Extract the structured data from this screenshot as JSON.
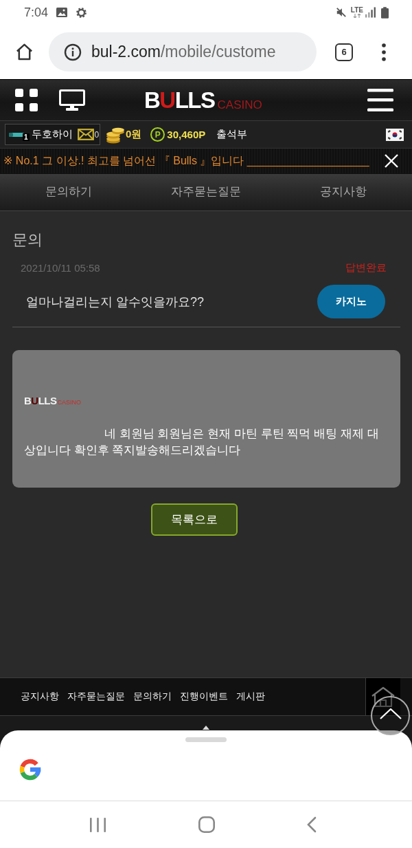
{
  "status_bar": {
    "time": "7:04",
    "network": "LTE"
  },
  "browser": {
    "url_domain": "bul-2.com",
    "url_path": "/mobile/custome",
    "tab_count": "6"
  },
  "header": {
    "logo": "BULLS",
    "logo_sub": "CASINO"
  },
  "user_bar": {
    "rank": "1",
    "nickname": "두호하이",
    "messages": "0",
    "money": "0원",
    "points_symbol": "P",
    "points": "30,460P",
    "attendance": "출석부"
  },
  "notice": {
    "text": "※ No.1 그 이상.! 최고를 넘어선 『 Bulls 』입니다 ____________________"
  },
  "tabs": [
    {
      "label": "문의하기",
      "selected": false
    },
    {
      "label": "자주묻는질문",
      "selected": false
    },
    {
      "label": "공지사항",
      "selected": false
    }
  ],
  "inquiry": {
    "heading": "문의",
    "date": "2021/10/11 05:58",
    "status": "답변완료",
    "question": "얼마나걸리는지 알수잇을까요??",
    "category": "카지노"
  },
  "answer": {
    "logo": "BULLS",
    "logo_sub": "CASINO",
    "text": "네 회원님 회원님은 현재 마틴 루틴 찍먹 배팅 재제 대상입니다 확인후 쪽지발송해드리겠습니다"
  },
  "back_button": "목록으로",
  "footer": {
    "links": [
      "공지사항",
      "자주묻는질문",
      "문의하기",
      "진행이벤트",
      "게시판"
    ]
  }
}
